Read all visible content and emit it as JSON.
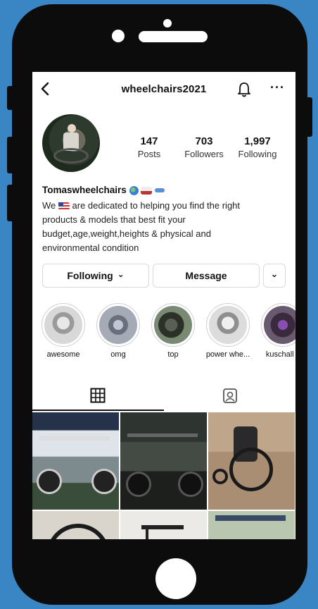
{
  "profile": {
    "username": "wheelchairs2021",
    "display_name": "Tomaswheelchairs",
    "bio_lines": [
      "are dedicated to helping you find the right",
      "products & models that best fit your",
      "budget,age,weight,heights & physical and",
      "environmental condition"
    ],
    "bio_prefix": "We"
  },
  "stats": [
    {
      "value": "147",
      "label": "Posts"
    },
    {
      "value": "703",
      "label": "Followers"
    },
    {
      "value": "1,997",
      "label": "Following"
    }
  ],
  "buttons": {
    "following": "Following",
    "following_chevron": "⌄",
    "message": "Message",
    "dropdown": "⌄"
  },
  "highlights": [
    {
      "label": "awesome"
    },
    {
      "label": "omg"
    },
    {
      "label": "top"
    },
    {
      "label": "power whe..."
    },
    {
      "label": "kuschall c"
    }
  ],
  "tabs": [
    {
      "icon": "grid-icon"
    },
    {
      "icon": "tagged-icon"
    }
  ],
  "icons": {
    "back": "chevron-left-icon",
    "bell": "bell-icon",
    "more": "more-icon"
  },
  "more_glyph": "···",
  "colors": {
    "background": "#3a86c4",
    "phone": "#0c0c0c",
    "border": "#dadada"
  }
}
